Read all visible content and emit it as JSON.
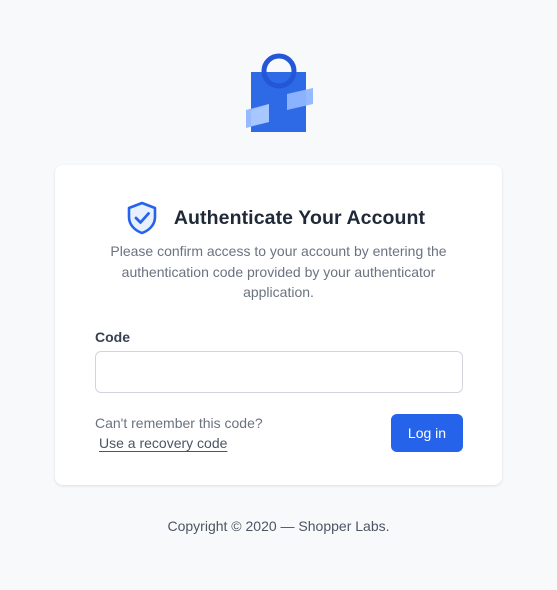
{
  "colors": {
    "primary": "#2563eb",
    "logo_blue": "#2f6ae6",
    "logo_light": "#a9c9ff",
    "page_bg": "#f8f9fb",
    "card_bg": "#ffffff"
  },
  "icons": {
    "logo": "shopping-bag-logo",
    "heading": "shield-check-icon"
  },
  "auth": {
    "title": "Authenticate Your Account",
    "description": "Please confirm access to your account by entering the authentication code provided by your authenticator application.",
    "code_label": "Code",
    "code_value": "",
    "code_placeholder": "",
    "remember_text": "Can't remember this code?",
    "recovery_link": "Use a recovery code",
    "login_label": "Log in"
  },
  "footer": {
    "copyright": "Copyright © 2020 — Shopper Labs."
  }
}
